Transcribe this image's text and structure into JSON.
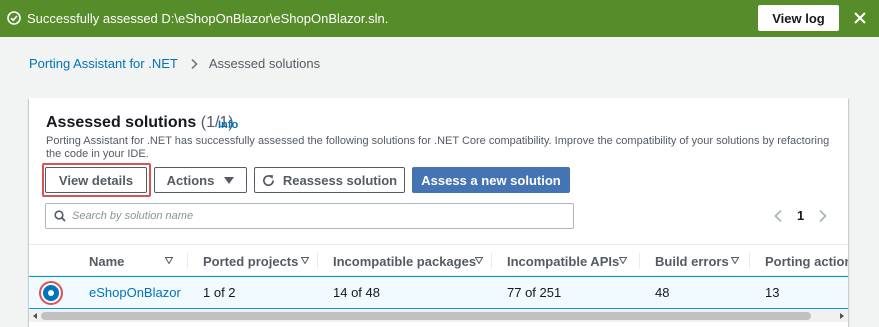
{
  "flash": {
    "message": "Successfully assessed D:\\eShopOnBlazor\\eShopOnBlazor.sln.",
    "view_log": "View log",
    "color": "#578c2a"
  },
  "breadcrumb": {
    "root": "Porting Assistant for .NET",
    "current": "Assessed solutions"
  },
  "panel": {
    "title": "Assessed solutions",
    "count": "(1/1)",
    "info": "Info",
    "description": "Porting Assistant for .NET has successfully assessed the following solutions for .NET Core compatibility. Improve the compatibility of your solutions by refactoring the code in your IDE."
  },
  "toolbar": {
    "view_details": "View details",
    "actions": "Actions",
    "reassess": "Reassess solution",
    "assess_new": "Assess a new solution",
    "primary_color": "#4574b5"
  },
  "search": {
    "placeholder": "Search by solution name",
    "value": ""
  },
  "pagination": {
    "current_page": "1"
  },
  "table": {
    "columns": [
      "Name",
      "Ported projects",
      "Incompatible packages",
      "Incompatible APIs",
      "Build errors",
      "Porting actions"
    ],
    "rows": [
      {
        "selected": true,
        "name": "eShopOnBlazor",
        "ported_projects": "1 of 2",
        "incompatible_packages": "14 of 48",
        "incompatible_apis": "77 of 251",
        "build_errors": "48",
        "porting_actions": "13"
      }
    ]
  },
  "icons": {
    "flash_status": "check-circle-icon",
    "flash_close": "close-icon",
    "breadcrumb_sep": "chevron-right-icon",
    "actions_caret": "caret-down-icon",
    "reassess": "refresh-icon",
    "search": "search-icon",
    "sort": "sort-caret-icon"
  }
}
